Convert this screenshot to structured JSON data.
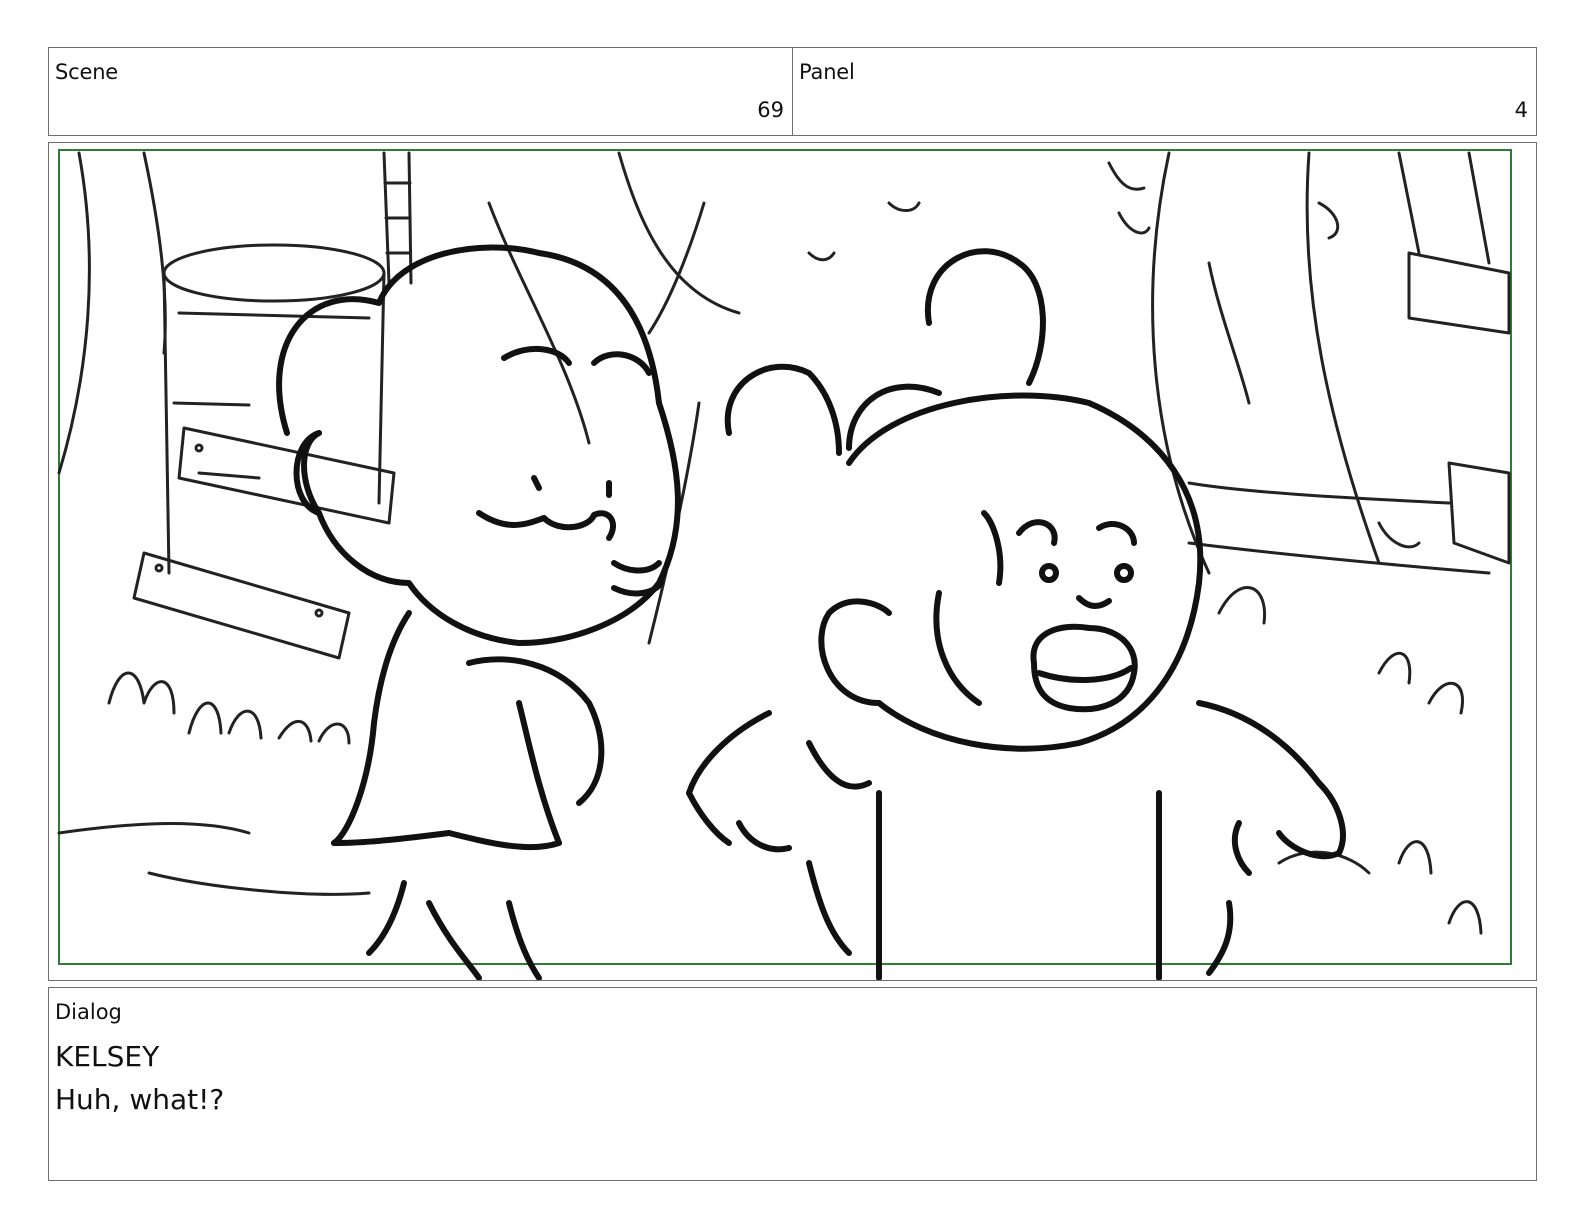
{
  "header": {
    "scene_label": "Scene",
    "scene_value": "69",
    "panel_label": "Panel",
    "panel_value": "4"
  },
  "panel": {
    "frame_color": "#2e7d32",
    "ink_color": "#111111"
  },
  "dialog": {
    "label": "Dialog",
    "speaker": "KELSEY",
    "line": "Huh, what!?"
  }
}
